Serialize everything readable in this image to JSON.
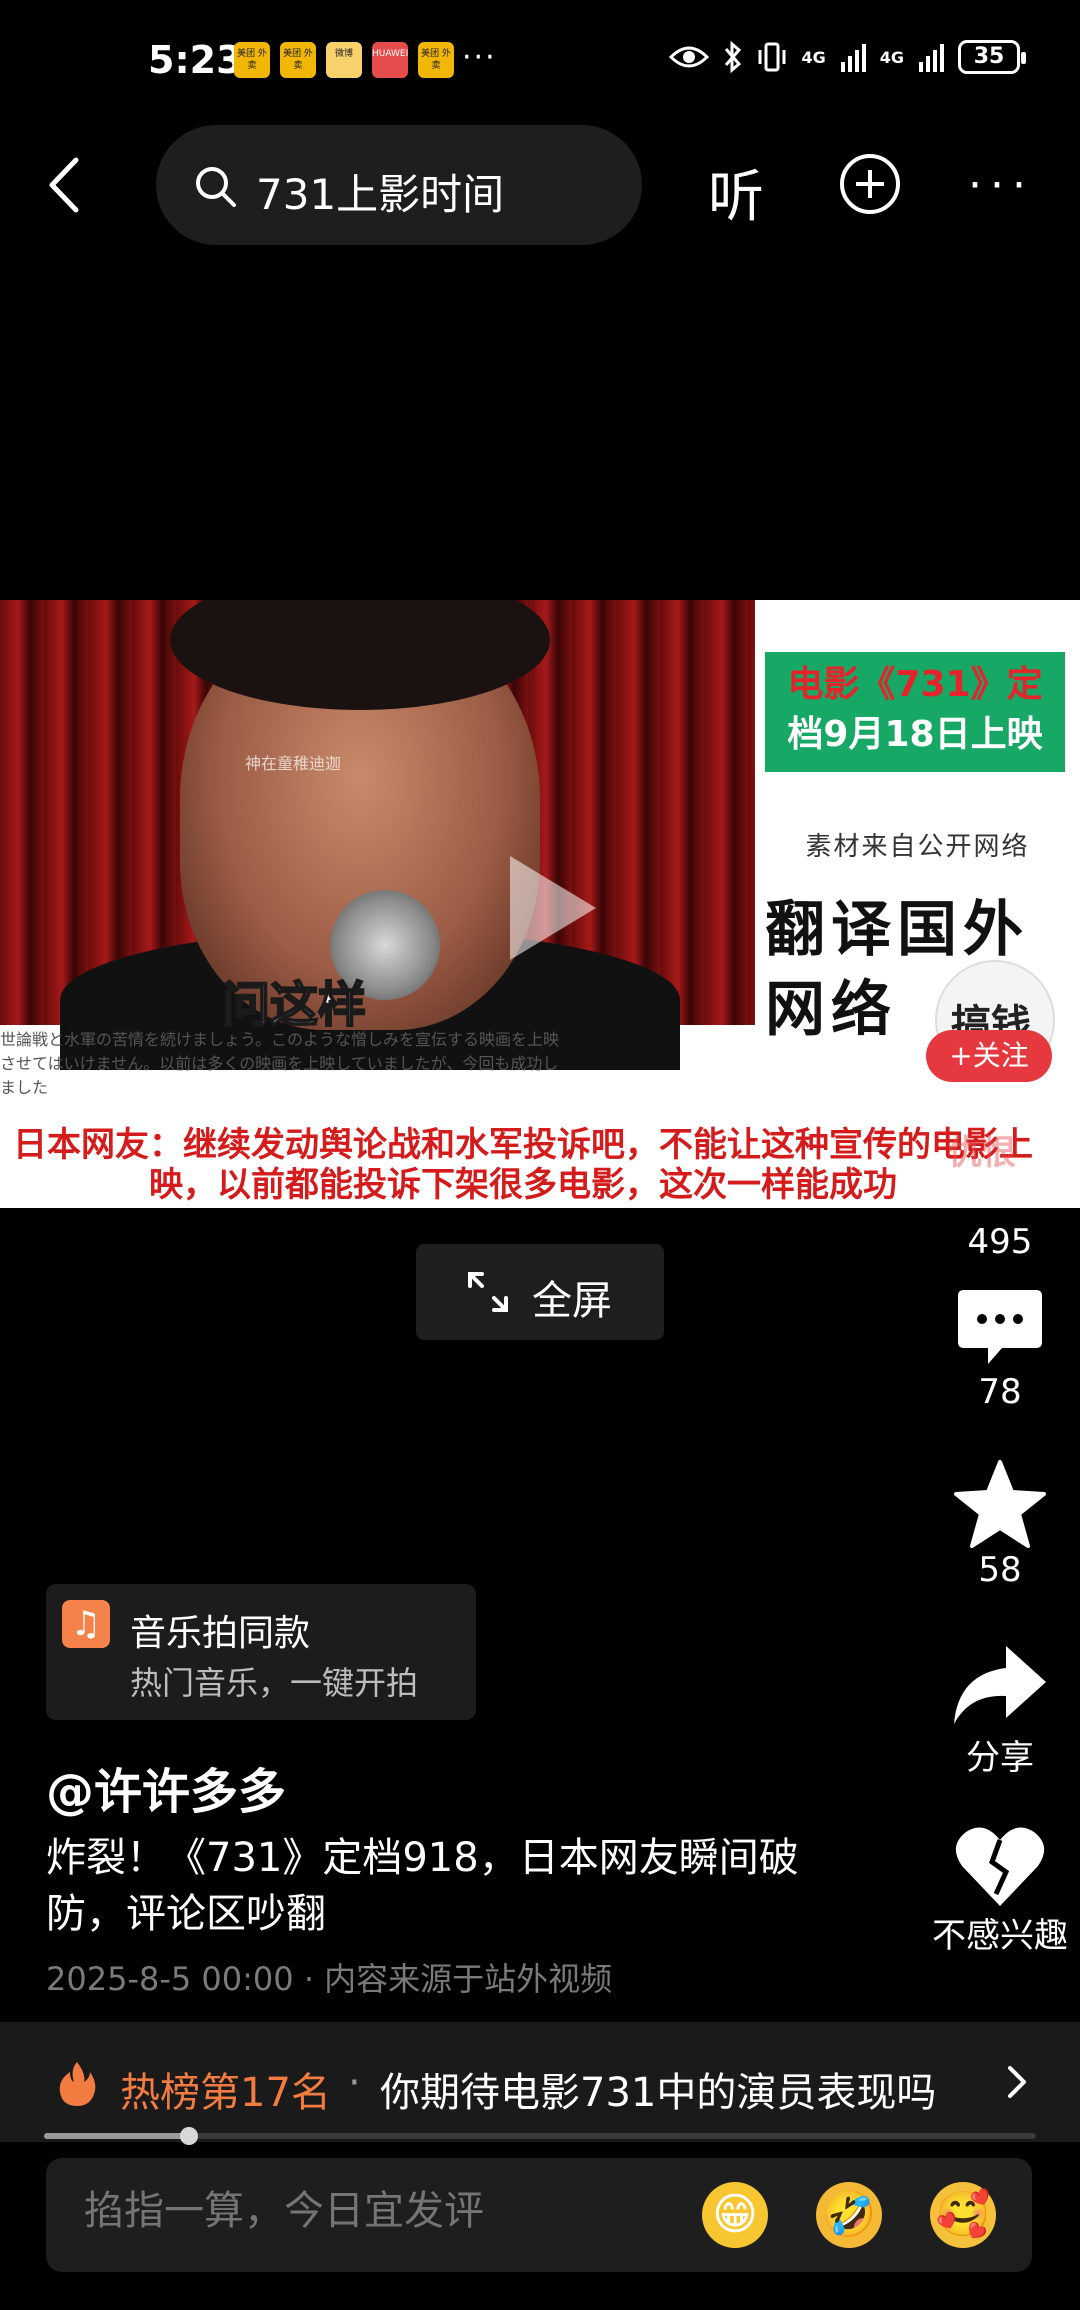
{
  "status_bar": {
    "time": "5:23",
    "notifications": [
      "美团\n外卖",
      "美团\n外卖",
      "微博",
      "HUAWEI",
      "美团\n外卖"
    ],
    "more_dots": "···",
    "signal_1": "4G",
    "signal_2": "4G",
    "battery": "35"
  },
  "search": {
    "query": "731上影时间"
  },
  "nav": {
    "listen_label": "听"
  },
  "video": {
    "caption": "问这样",
    "watermark": "神在童稚迪迦",
    "jp_text": "世論戦と水軍の苦情を続けましょう。このような憎しみを宣伝する映画を上映させてはいけません。以前は多くの映画を上映していましたが、今回も成功しました",
    "red_subtitle": "日本网友：继续发动舆论战和水军投诉吧，不能让这种宣传的电影上映，以前都能投诉下架很多电影，这次一样能成功",
    "side_banner_line1_a": "电影《",
    "side_banner_line1_b": "731",
    "side_banner_line1_c": "》定",
    "side_banner_line2": "档9月18日上映",
    "source_text": "素材来自公开网络",
    "big_text": "翻译国外网络",
    "stamp_text": "搞钱",
    "overlay_word": "仇恨"
  },
  "follow_label": "+关注",
  "fullscreen_label": "全屏",
  "rail": {
    "likes": "495",
    "comments": "78",
    "favorites": "58",
    "share_label": "分享",
    "dislike_label": "不感兴趣"
  },
  "music": {
    "title": "音乐拍同款",
    "subtitle": "热门音乐，一键开拍"
  },
  "post": {
    "author": "@许许多多",
    "title": "炸裂！《731》定档918，日本网友瞬间破防，评论区吵翻",
    "meta": "2025-8-5 00:00 · 内容来源于站外视频"
  },
  "hot": {
    "rank": "热榜第17名",
    "separator": "·",
    "topic": "你期待电影731中的演员表现吗"
  },
  "progress": {
    "fraction": 0.146
  },
  "comment": {
    "placeholder": "掐指一算，今日宜发评",
    "emojis": [
      "😁",
      "🤣",
      "🥰"
    ]
  }
}
